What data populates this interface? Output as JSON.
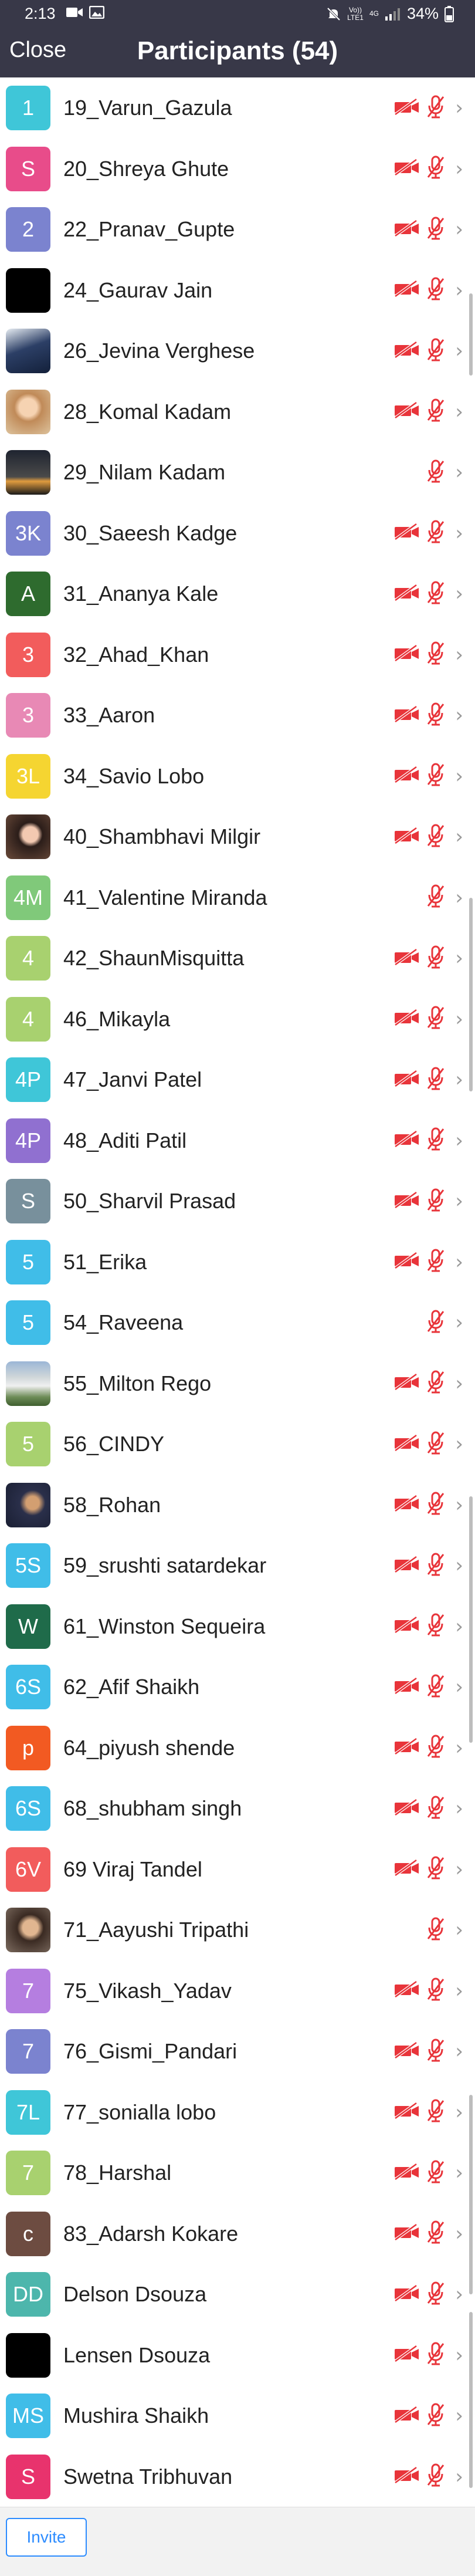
{
  "status_bar": {
    "time": "2:13",
    "network_top": "Vo))",
    "network_mid": "LTE1",
    "network_sig": "4G",
    "battery": "34%"
  },
  "header": {
    "close_label": "Close",
    "title": "Participants (54)"
  },
  "participants": [
    {
      "initials": "1",
      "name": "19_Varun_Gazula",
      "color": "#3fc6d8",
      "video_muted": true
    },
    {
      "initials": "S",
      "name": "20_Shreya Ghute",
      "color": "#e84c8a",
      "video_muted": true
    },
    {
      "initials": "2",
      "name": "22_Pranav_Gupte",
      "color": "#7b83cf",
      "video_muted": true
    },
    {
      "initials": "",
      "name": "24_Gaurav Jain",
      "color": "#000000",
      "video_muted": true
    },
    {
      "initials": "",
      "name": "26_Jevina Verghese",
      "color": "#2b3b5c",
      "video_muted": true
    },
    {
      "initials": "",
      "name": "28_Komal Kadam",
      "color": "#c8966a",
      "video_muted": true
    },
    {
      "initials": "",
      "name": "29_Nilam Kadam",
      "color": "#333",
      "video_muted": false
    },
    {
      "initials": "3K",
      "name": "30_Saeesh Kadge",
      "color": "#7b83cf",
      "video_muted": true
    },
    {
      "initials": "A",
      "name": "31_Ananya Kale",
      "color": "#2e6b2e",
      "video_muted": true
    },
    {
      "initials": "3",
      "name": "32_Ahad_Khan",
      "color": "#f25c5c",
      "video_muted": true
    },
    {
      "initials": "3",
      "name": "33_Aaron",
      "color": "#e889b5",
      "video_muted": true
    },
    {
      "initials": "3L",
      "name": "34_Savio Lobo",
      "color": "#f5d531",
      "video_muted": true
    },
    {
      "initials": "",
      "name": "40_Shambhavi Milgir",
      "color": "#333",
      "video_muted": true
    },
    {
      "initials": "4M",
      "name": "41_Valentine Miranda",
      "color": "#80c97a",
      "video_muted": false
    },
    {
      "initials": "4",
      "name": "42_ShaunMisquitta",
      "color": "#a8d16f",
      "video_muted": true
    },
    {
      "initials": "4",
      "name": "46_Mikayla",
      "color": "#a8d16f",
      "video_muted": true
    },
    {
      "initials": "4P",
      "name": "47_Janvi Patel",
      "color": "#3fc6d8",
      "video_muted": true
    },
    {
      "initials": "4P",
      "name": "48_Aditi Patil",
      "color": "#9070d0",
      "video_muted": true
    },
    {
      "initials": "S",
      "name": "50_Sharvil Prasad",
      "color": "#78909c",
      "video_muted": true
    },
    {
      "initials": "5",
      "name": "51_Erika",
      "color": "#40bde8",
      "video_muted": true
    },
    {
      "initials": "5",
      "name": "54_Raveena",
      "color": "#40bde8",
      "video_muted": false
    },
    {
      "initials": "",
      "name": "55_Milton Rego",
      "color": "#6d8c57",
      "video_muted": true
    },
    {
      "initials": "5",
      "name": "56_CINDY",
      "color": "#a8d16f",
      "video_muted": true
    },
    {
      "initials": "",
      "name": "58_Rohan",
      "color": "#2a2f4a",
      "video_muted": true
    },
    {
      "initials": "5S",
      "name": "59_srushti satardekar",
      "color": "#40bde8",
      "video_muted": true
    },
    {
      "initials": "W",
      "name": "61_Winston Sequeira",
      "color": "#1f6b4a",
      "video_muted": true
    },
    {
      "initials": "6S",
      "name": "62_Afif Shaikh",
      "color": "#40bde8",
      "video_muted": true
    },
    {
      "initials": "p",
      "name": "64_piyush shende",
      "color": "#f25a22",
      "video_muted": true
    },
    {
      "initials": "6S",
      "name": "68_shubham singh",
      "color": "#40bde8",
      "video_muted": true
    },
    {
      "initials": "6V",
      "name": "69 Viraj Tandel",
      "color": "#f25c5c",
      "video_muted": true
    },
    {
      "initials": "",
      "name": "71_Aayushi Tripathi",
      "color": "#7d6c60",
      "video_muted": false
    },
    {
      "initials": "7",
      "name": "75_Vikash_Yadav",
      "color": "#b57ee0",
      "video_muted": true
    },
    {
      "initials": "7",
      "name": "76_Gismi_Pandari",
      "color": "#7b83cf",
      "video_muted": true
    },
    {
      "initials": "7L",
      "name": "77_sonialla lobo",
      "color": "#3fc6d8",
      "video_muted": true
    },
    {
      "initials": "7",
      "name": "78_Harshal",
      "color": "#a8d16f",
      "video_muted": true
    },
    {
      "initials": "c",
      "name": "83_Adarsh Kokare",
      "color": "#6d4c41",
      "video_muted": true
    },
    {
      "initials": "DD",
      "name": "Delson Dsouza",
      "color": "#4db6ac",
      "video_muted": true
    },
    {
      "initials": "",
      "name": "Lensen Dsouza",
      "color": "#000000",
      "video_muted": true
    },
    {
      "initials": "MS",
      "name": "Mushira Shaikh",
      "color": "#40bde8",
      "video_muted": true
    },
    {
      "initials": "S",
      "name": "Swetna Tribhuvan",
      "color": "#e8336d",
      "video_muted": true
    }
  ],
  "footer": {
    "invite_label": "Invite"
  }
}
